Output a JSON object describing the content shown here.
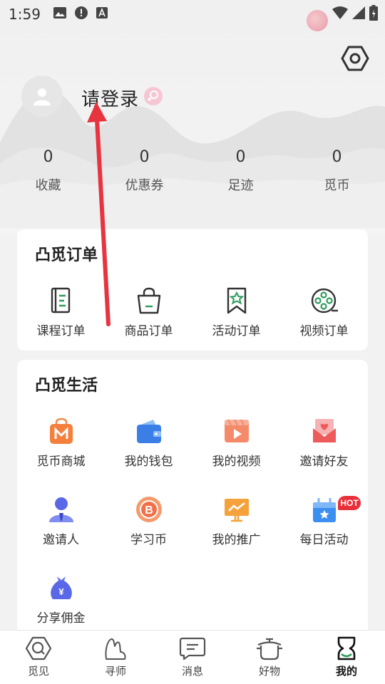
{
  "status_bar": {
    "time": "1:59"
  },
  "header": {
    "login_label": "请登录",
    "icons": {
      "settings": "hexagon-settings-icon",
      "avatar": "person-icon",
      "gender": "female-icon"
    }
  },
  "stats": [
    {
      "value": "0",
      "label": "收藏"
    },
    {
      "value": "0",
      "label": "优惠券"
    },
    {
      "value": "0",
      "label": "足迹"
    },
    {
      "value": "0",
      "label": "觅币"
    }
  ],
  "orders": {
    "title": "凸觅订单",
    "items": [
      {
        "label": "课程订单",
        "icon": "document-icon"
      },
      {
        "label": "商品订单",
        "icon": "shopping-bag-icon"
      },
      {
        "label": "活动订单",
        "icon": "bookmark-star-icon"
      },
      {
        "label": "视频订单",
        "icon": "film-reel-icon"
      }
    ]
  },
  "life": {
    "title": "凸觅生活",
    "items": [
      {
        "label": "觅币商城",
        "icon": "mall-bag-icon"
      },
      {
        "label": "我的钱包",
        "icon": "wallet-icon"
      },
      {
        "label": "我的视频",
        "icon": "video-play-icon"
      },
      {
        "label": "邀请好友",
        "icon": "invite-envelope-icon"
      },
      {
        "label": "邀请人",
        "icon": "person-badge-icon"
      },
      {
        "label": "学习币",
        "icon": "coin-b-icon"
      },
      {
        "label": "我的推广",
        "icon": "promotion-chart-icon"
      },
      {
        "label": "每日活动",
        "icon": "gift-calendar-icon"
      },
      {
        "label": "分享佣金",
        "icon": "money-bag-icon"
      }
    ],
    "hot_badge": "HOT"
  },
  "bottom_nav": [
    {
      "label": "觅见",
      "icon": "search-icon"
    },
    {
      "label": "寻师",
      "icon": "teacher-hand-icon"
    },
    {
      "label": "消息",
      "icon": "message-icon"
    },
    {
      "label": "好物",
      "icon": "pot-icon"
    },
    {
      "label": "我的",
      "icon": "profile-icon",
      "active": true
    }
  ],
  "colors": {
    "accent_orange": "#f57f3c",
    "accent_blue": "#3b7fe6",
    "accent_red": "#ee5b5b",
    "annotation_arrow": "#e8343f",
    "brand_green": "#2d9c5a"
  }
}
